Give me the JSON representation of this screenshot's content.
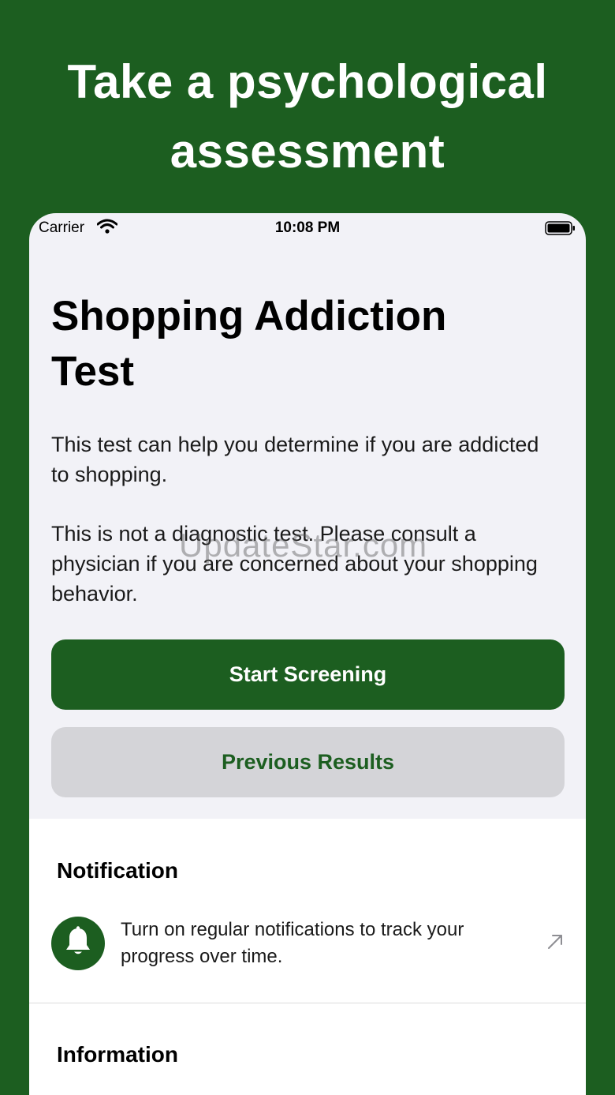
{
  "headline": {
    "line1": "Take a psychological",
    "line2": "assessment"
  },
  "status_bar": {
    "carrier": "Carrier",
    "time": "10:08 PM"
  },
  "main": {
    "title_line1": "Shopping Addiction",
    "title_line2": "Test",
    "description_1": "This test can help you determine if you are addicted to shopping.",
    "description_2": "This is not a diagnostic test. Please consult a physician if you are concerned about your shopping behavior.",
    "watermark": "UpdateStar.com",
    "start_button": "Start Screening",
    "previous_button": "Previous Results"
  },
  "notification": {
    "section_title": "Notification",
    "text": "Turn on regular notifications to track your progress over time."
  },
  "information": {
    "section_title": "Information"
  },
  "colors": {
    "brand_green": "#1c5e20",
    "background": "#f2f2f7",
    "secondary_button": "#d4d4d8"
  }
}
